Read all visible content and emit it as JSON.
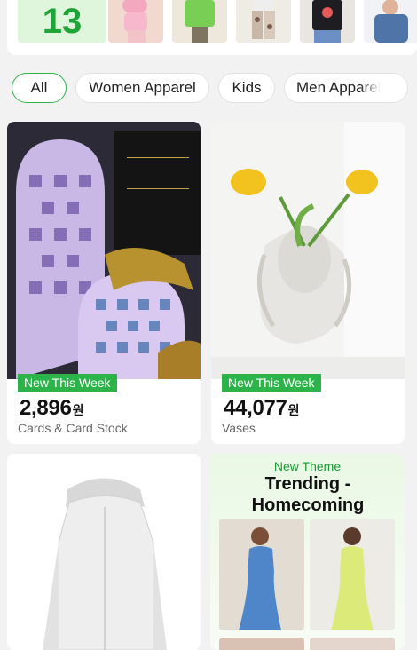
{
  "top_strip": {
    "date_number": "13",
    "thumbnails": [
      {
        "icon": "pink-outfit-thumbnail"
      },
      {
        "icon": "green-tshirt-thumbnail"
      },
      {
        "icon": "patterned-pants-thumbnail"
      },
      {
        "icon": "black-tshirt-thumbnail"
      },
      {
        "icon": "denim-jacket-thumbnail"
      }
    ]
  },
  "filters": {
    "chips": [
      "All",
      "Women Apparel",
      "Kids",
      "Men Apparel"
    ],
    "active": "All",
    "accent_color": "#2cb44a"
  },
  "products": [
    {
      "badge": "New This Week",
      "price": "2,896",
      "currency": "원",
      "category": "Cards & Card Stock",
      "image_icon": "stained-glass-cards-image"
    },
    {
      "badge": "New This Week",
      "price": "44,077",
      "currency": "원",
      "category": "Vases",
      "image_icon": "face-vase-tulips-image"
    },
    {
      "image_icon": "white-hooded-jacket-image"
    }
  ],
  "theme": {
    "label": "New Theme",
    "title": "Trending - Homecoming",
    "image_icons": [
      "blue-gown-image",
      "yellow-gown-image"
    ]
  }
}
